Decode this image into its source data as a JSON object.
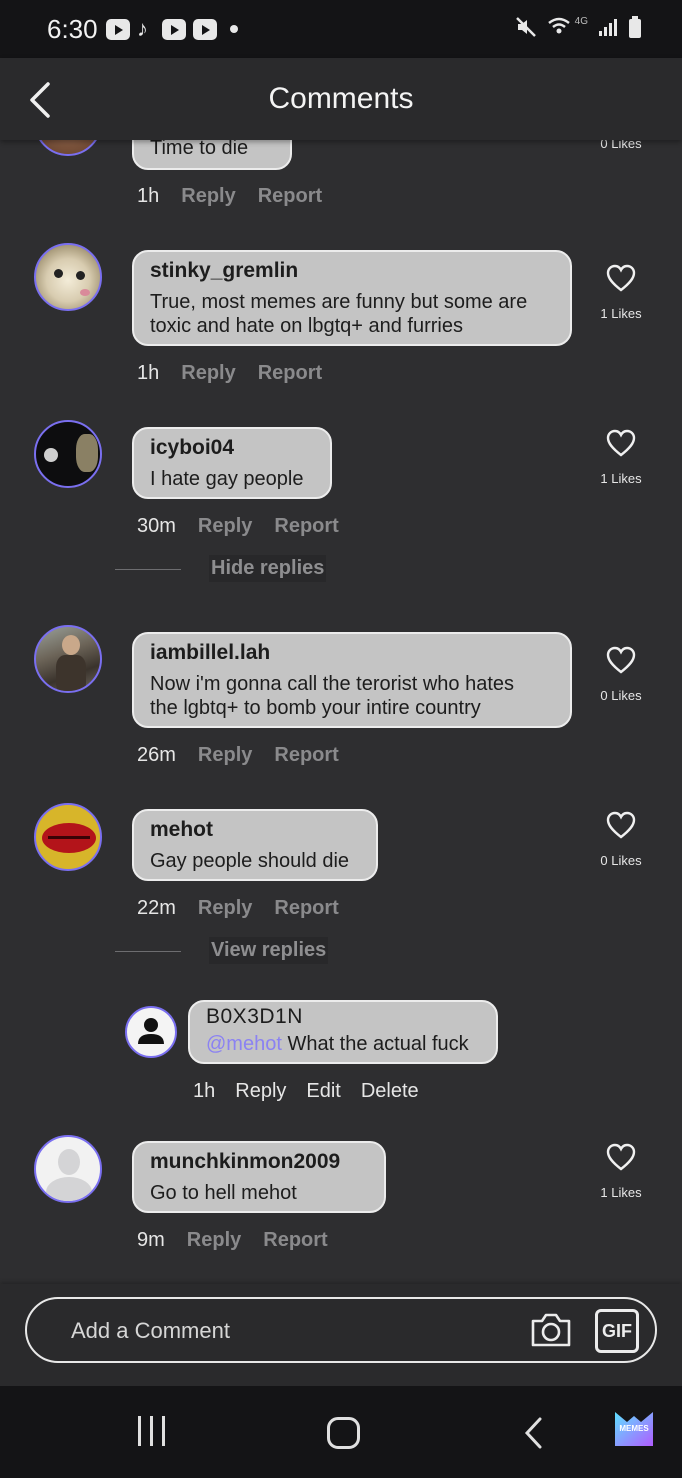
{
  "status": {
    "time": "6:30",
    "network": "4G"
  },
  "header": {
    "title": "Comments"
  },
  "comments": [
    {
      "text": "Time to die",
      "likes": "0 Likes",
      "time": "1h",
      "reply": "Reply",
      "report": "Report"
    },
    {
      "user": "stinky_gremlin",
      "text1": "True, most memes are funny but some are",
      "text2": "toxic and hate on lbgtq+ and furries",
      "likes": "1 Likes",
      "time": "1h",
      "reply": "Reply",
      "report": "Report"
    },
    {
      "user": "icyboi04",
      "text": "I hate gay people",
      "likes": "1 Likes",
      "time": "30m",
      "reply": "Reply",
      "report": "Report",
      "toggle": "Hide replies"
    },
    {
      "user": "iambillel.lah",
      "text1": "Now i'm gonna call the terorist who hates",
      "text2": "the lgbtq+ to bomb your intire country",
      "likes": "0 Likes",
      "time": "26m",
      "reply": "Reply",
      "report": "Report"
    },
    {
      "user": "mehot",
      "text": "Gay people should die",
      "likes": "0 Likes",
      "time": "22m",
      "reply": "Reply",
      "report": "Report",
      "toggle": "View replies"
    },
    {
      "user": "munchkinmon2009",
      "text": "Go to hell mehot",
      "likes": "1 Likes",
      "time": "9m",
      "reply": "Reply",
      "report": "Report"
    }
  ],
  "own_reply": {
    "user": "B0X3D1N",
    "mention": "@mehot",
    "text": " What the actual fuck",
    "time": "1h",
    "reply": "Reply",
    "edit": "Edit",
    "delete": "Delete"
  },
  "composer": {
    "placeholder": "Add a Comment",
    "gif_label": "GIF"
  },
  "navbar": {
    "logo_text": "MEMES"
  },
  "colors": {
    "accent": "#7a6ff0",
    "mention": "#8b82f2",
    "bubble": "#c4c4c4",
    "background": "#2e2e30"
  },
  "icons": [
    "back-arrow-icon",
    "heart-icon",
    "camera-icon",
    "gif-icon",
    "mute-icon",
    "wifi-icon",
    "signal-icon",
    "battery-icon"
  ]
}
